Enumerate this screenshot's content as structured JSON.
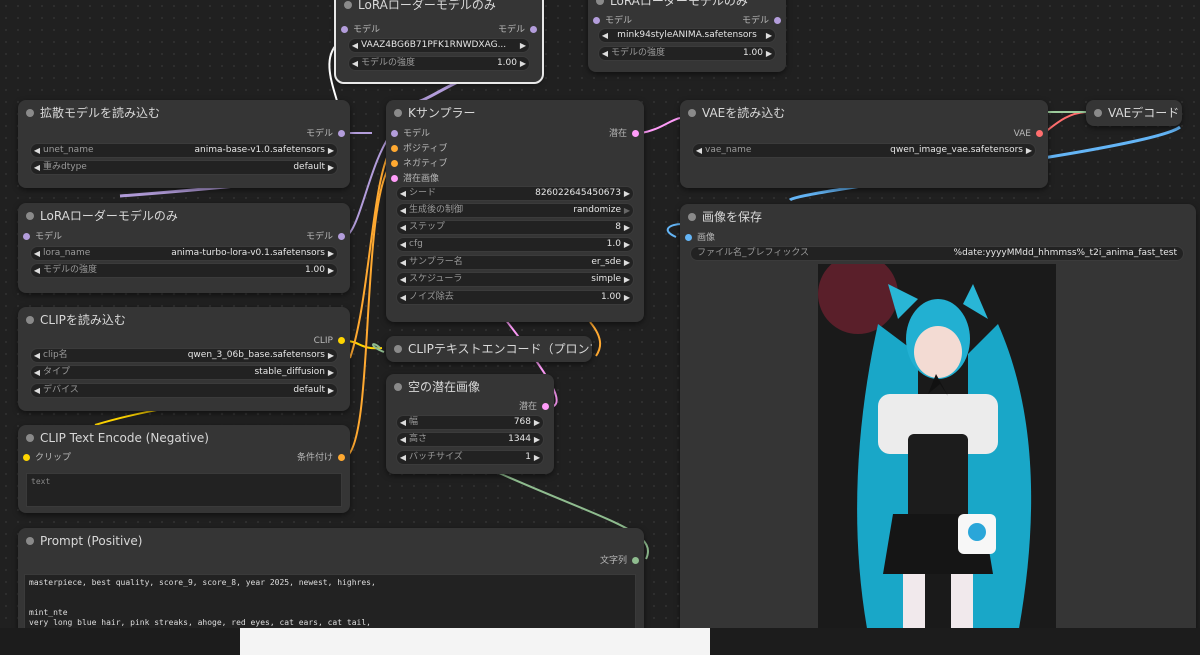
{
  "nodes": {
    "lora_top": {
      "title": "LoRAローダーモデルのみ",
      "in": "モデル",
      "out": "モデル",
      "lora_name": "VAAZ4BG6B71PFK1RNWDXAG...",
      "strength_label": "モデルの強度",
      "strength": "1.00"
    },
    "lora_right": {
      "title": "LoRAローダーモデルのみ",
      "in": "モデル",
      "out": "モデル",
      "lora_name": "mink94styleANIMA.safetensors",
      "strength_label": "モデルの強度",
      "strength": "1.00"
    },
    "diffusion": {
      "title": "拡散モデルを読み込む",
      "out": "モデル",
      "unet_label": "unet_name",
      "unet": "anima-base-v1.0.safetensors",
      "dtype_label": "重みdtype",
      "dtype": "default"
    },
    "lora_left": {
      "title": "LoRAローダーモデルのみ",
      "in": "モデル",
      "out": "モデル",
      "name_label": "lora_name",
      "name": "anima-turbo-lora-v0.1.safetensors",
      "strength_label": "モデルの強度",
      "strength": "1.00"
    },
    "clip_loader": {
      "title": "CLIPを読み込む",
      "out": "CLIP",
      "clip_label": "clip名",
      "clip": "qwen_3_06b_base.safetensors",
      "type_label": "タイプ",
      "type": "stable_diffusion",
      "device_label": "デバイス",
      "device": "default"
    },
    "neg": {
      "title": "CLIP Text Encode (Negative)",
      "in": "クリップ",
      "out": "条件付け",
      "placeholder": "text"
    },
    "pos": {
      "title": "Prompt (Positive)",
      "out": "文字列",
      "text_line1": "masterpiece, best quality, score_9, score_8, year 2025, newest, highres,",
      "text_line2": "mint_nte",
      "text_line3": "very long blue hair, pink streaks, ahoge, red eyes, cat ears, cat tail,"
    },
    "ksampler": {
      "title": "Kサンプラー",
      "in_model": "モデル",
      "in_pos": "ポジティブ",
      "in_neg": "ネガティブ",
      "in_latent": "潜在画像",
      "out": "潜在",
      "seed_label": "シード",
      "seed": "826022645450673",
      "control_label": "生成後の制御",
      "control": "randomize",
      "steps_label": "ステップ",
      "steps": "8",
      "cfg_label": "cfg",
      "cfg": "1.0",
      "sampler_label": "サンプラー名",
      "sampler": "er_sde",
      "scheduler_label": "スケジューラ",
      "scheduler": "simple",
      "denoise_label": "ノイズ除去",
      "denoise": "1.00"
    },
    "clip_encode": {
      "title": "CLIPテキストエンコード（プロンプト）"
    },
    "empty_latent": {
      "title": "空の潜在画像",
      "out": "潜在",
      "width_label": "幅",
      "width": "768",
      "height_label": "高さ",
      "height": "1344",
      "batch_label": "バッチサイズ",
      "batch": "1"
    },
    "vae_loader": {
      "title": "VAEを読み込む",
      "out": "VAE",
      "vae_label": "vae_name",
      "vae": "qwen_image_vae.safetensors"
    },
    "vae_decode": {
      "title": "VAEデコード"
    },
    "save_image": {
      "title": "画像を保存",
      "in": "画像",
      "prefix_label": "ファイル名_プレフィックス",
      "prefix": "%date:yyyyMMdd_hhmmss%_t2i_anima_fast_test",
      "image_alt": "generated anime character preview"
    }
  },
  "colors": {
    "model": "#b39ddb",
    "clip": "#ffd500",
    "conditioning": "#ffa931",
    "latent": "#ff9cf9",
    "vae": "#ff6e6e",
    "image": "#64b5f6",
    "string": "#8fbc8f"
  }
}
